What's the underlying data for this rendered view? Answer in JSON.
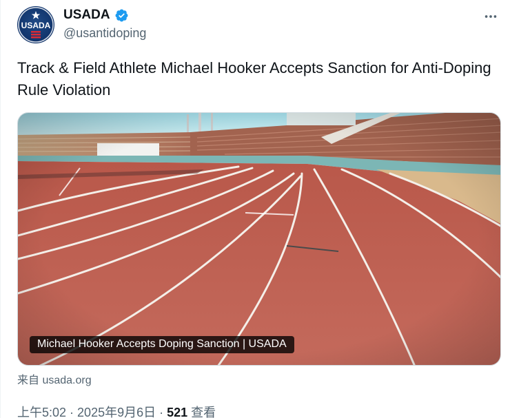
{
  "author": {
    "display_name": "USADA",
    "handle": "@usantidoping",
    "verified": true,
    "avatar_text": "USADA",
    "verified_color": "#1d9bf0"
  },
  "tweet": {
    "text": "Track & Field Athlete Michael Hooker Accepts Sanction for Anti-Doping Rule Violation"
  },
  "card": {
    "title": "Michael Hooker Accepts Doping Sanction | USADA",
    "image_icon": "running-track-photo",
    "source_label": "来自 usada.org"
  },
  "meta": {
    "time": "上午5:02",
    "separator": " · ",
    "date": "2025年9月6日",
    "views_count": "521",
    "views_label": " 查看"
  },
  "icons": {
    "more": "more-horizontal-icon",
    "verified": "verified-badge-icon"
  }
}
